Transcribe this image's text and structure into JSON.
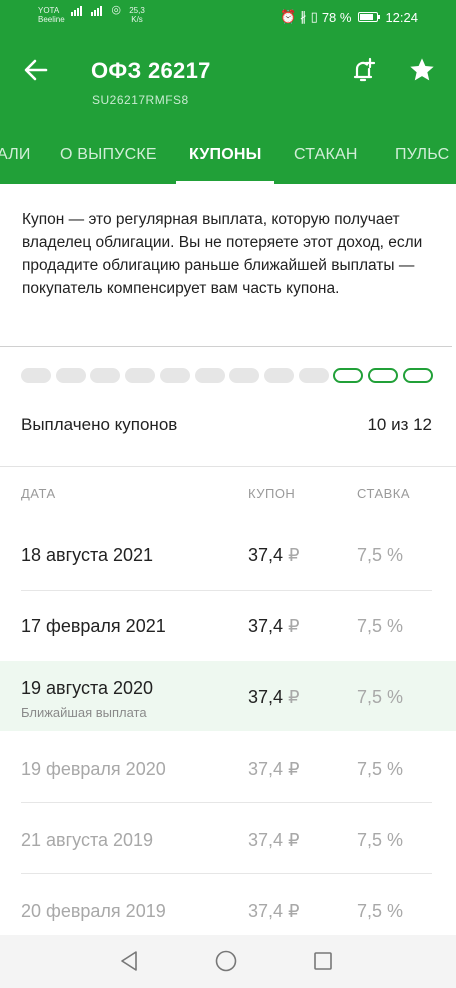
{
  "status_bar": {
    "carrier_top": "YOTA",
    "carrier_bottom": "Beeline",
    "speed_value": "25,3",
    "speed_unit": "K/s",
    "battery_percent": "78 %",
    "battery_level": 0.78,
    "time": "12:24"
  },
  "header": {
    "title": "ОФЗ 26217",
    "subtitle": "SU26217RMFS8"
  },
  "tabs": [
    {
      "label": "АЛИ"
    },
    {
      "label": "О ВЫПУСКЕ"
    },
    {
      "label": "КУПОНЫ",
      "active": true
    },
    {
      "label": "СТАКАН"
    },
    {
      "label": "ПУЛЬС"
    }
  ],
  "description": "Купон — это регулярная выплата, которую получает владелец облигации. Вы не потеряете этот доход, если продадите облигацию раньше ближайшей выплаты — покупатель компенсирует вам часть купона.",
  "coupon_progress": {
    "paid": 9,
    "total": 12
  },
  "paid_summary": {
    "label": "Выплачено купонов",
    "value": "10 из 12"
  },
  "table": {
    "headers": {
      "date": "ДАТА",
      "coupon": "КУПОН",
      "rate": "СТАВКА"
    },
    "rows": [
      {
        "date": "18 августа 2021",
        "amount": "37,4",
        "currency": "₽",
        "rate": "7,5 %",
        "status": "future"
      },
      {
        "date": "17 февраля 2021",
        "amount": "37,4",
        "currency": "₽",
        "rate": "7,5 %",
        "status": "future"
      },
      {
        "date": "19 августа 2020",
        "amount": "37,4",
        "currency": "₽",
        "rate": "7,5 %",
        "status": "nearest",
        "note": "Ближайшая выплата"
      },
      {
        "date": "19 февраля 2020",
        "amount": "37,4",
        "currency": "₽",
        "rate": "7,5 %",
        "status": "past"
      },
      {
        "date": "21 августа 2019",
        "amount": "37,4",
        "currency": "₽",
        "rate": "7,5 %",
        "status": "past"
      },
      {
        "date": "20 февраля 2019",
        "amount": "37,4",
        "currency": "₽",
        "rate": "7,5 %",
        "status": "past"
      }
    ]
  },
  "colors": {
    "brand": "#21a038",
    "nearest_bg": "#eef8f0"
  }
}
